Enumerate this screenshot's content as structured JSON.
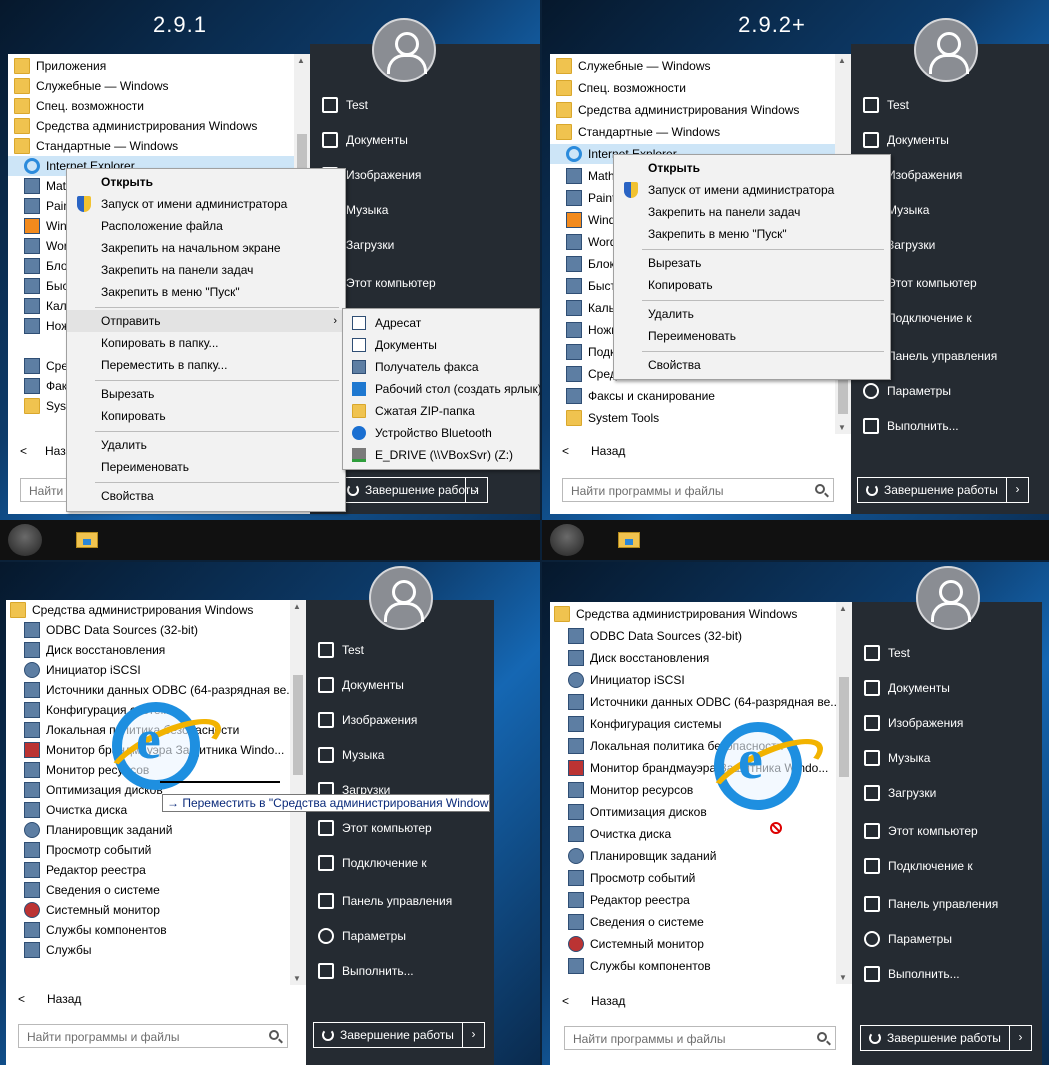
{
  "versions": {
    "v1": "2.9.1",
    "v2": "2.9.2+"
  },
  "right_menu": {
    "test": "Test",
    "documents": "Документы",
    "pictures": "Изображения",
    "music": "Музыка",
    "downloads": "Загрузки",
    "computer": "Этот компьютер",
    "connect": "Подключение к",
    "control_panel": "Панель управления",
    "settings": "Параметры",
    "run": "Выполнить..."
  },
  "shutdown": "Завершение работы",
  "search_placeholder": "Найти программы и файлы",
  "search_short": "Найти",
  "back": "Назад",
  "back_short": "Наз",
  "q1": {
    "list": [
      "Приложения",
      "Служебные — Windows",
      "Спец. возможности",
      "Средства администрирования Windows",
      "Стандартные — Windows",
      "Internet Explorer",
      "Math",
      "Paint",
      "Windows",
      "Wordpad",
      "Блокнот",
      "Быстрая помощь",
      "Калькулятор",
      "Ножницы",
      "Средство",
      "Факсы",
      "System"
    ],
    "ctx": {
      "open": "Открыть",
      "run_admin": "Запуск от имени администратора",
      "file_loc": "Расположение файла",
      "pin_start": "Закрепить на начальном экране",
      "pin_taskbar": "Закрепить на панели задач",
      "pin_menu": "Закрепить в меню \"Пуск\"",
      "send": "Отправить",
      "copy_to": "Копировать в папку...",
      "move_to": "Переместить в папку...",
      "cut": "Вырезать",
      "copy": "Копировать",
      "delete": "Удалить",
      "rename": "Переименовать",
      "props": "Свойства"
    },
    "sub": [
      "Адресат",
      "Документы",
      "Получатель факса",
      "Рабочий стол (создать ярлык)",
      "Сжатая ZIP-папка",
      "Устройство Bluetooth",
      "E_DRIVE (\\\\VBoxSvr) (Z:)"
    ]
  },
  "q2": {
    "list": [
      "Служебные — Windows",
      "Спец. возможности",
      "Средства администрирования Windows",
      "Стандартные — Windows",
      "Internet Explorer",
      "Math",
      "Paint",
      "Windows",
      "Wordpad",
      "Блокнот",
      "Быстрая помощь",
      "Калькулятор",
      "Ножницы",
      "Подключение",
      "Средство",
      "Факсы и сканирование",
      "System Tools"
    ],
    "ctx": {
      "open": "Открыть",
      "run_admin": "Запуск от имени администратора",
      "pin_taskbar": "Закрепить на панели задач",
      "pin_menu": "Закрепить в меню \"Пуск\"",
      "cut": "Вырезать",
      "copy": "Копировать",
      "delete": "Удалить",
      "rename": "Переименовать",
      "props": "Свойства"
    }
  },
  "q3": {
    "list": [
      "Средства администрирования Windows",
      "ODBC Data Sources (32-bit)",
      "Диск восстановления",
      "Инициатор iSCSI",
      "Источники данных ODBC (64-разрядная ве...",
      "Конфигурация системы",
      "Локальная политика безопасности",
      "Монитор брандмауэра Защитника Windo...",
      "Монитор ресурсов",
      "Оптимизация дисков",
      "Очистка диска",
      "Планировщик заданий",
      "Просмотр событий",
      "Редактор реестра",
      "Сведения о системе",
      "Системный монитор",
      "Службы компонентов",
      "Службы"
    ],
    "drop_tip": "→ Переместить в \"Средства администрирования Window"
  },
  "q4": {
    "list": [
      "Средства администрирования Windows",
      "ODBC Data Sources (32-bit)",
      "Диск восстановления",
      "Инициатор iSCSI",
      "Источники данных ODBC (64-разрядная ве...",
      "Конфигурация системы",
      "Локальная политика безопасности",
      "Монитор брандмауэра Защитника Windo...",
      "Монитор ресурсов",
      "Оптимизация дисков",
      "Очистка диска",
      "Планировщик заданий",
      "Просмотр событий",
      "Редактор реестра",
      "Сведения о системе",
      "Системный монитор",
      "Службы компонентов"
    ]
  }
}
